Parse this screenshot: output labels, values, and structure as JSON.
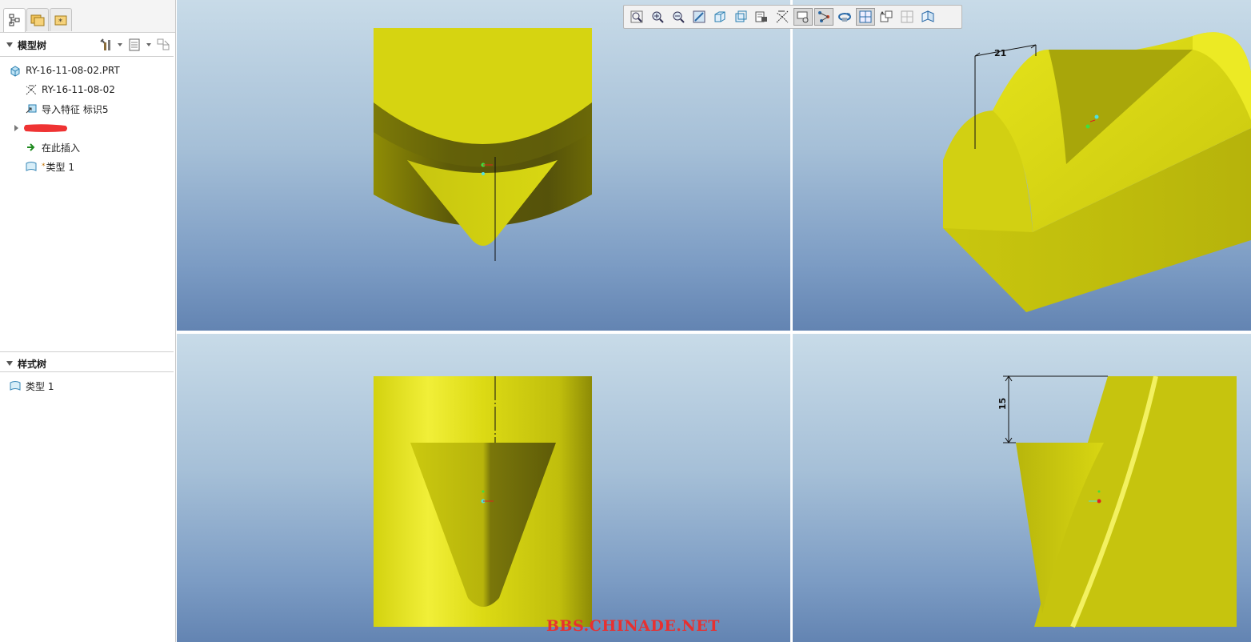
{
  "model_tree": {
    "title": "模型树",
    "items": [
      {
        "label": "RY-16-11-08-02.PRT",
        "icon": "part-icon"
      },
      {
        "label": "RY-16-11-08-02",
        "icon": "csys-icon"
      },
      {
        "label": "导入特征 标识5",
        "icon": "import-feature-icon"
      },
      {
        "label": "",
        "icon": "redacted-item"
      },
      {
        "label": "在此插入",
        "icon": "insert-here-arrow-icon"
      },
      {
        "label": "类型 1",
        "icon": "style-icon"
      }
    ]
  },
  "style_tree": {
    "title": "样式树",
    "items": [
      {
        "label": "类型 1",
        "icon": "style-icon"
      }
    ]
  },
  "toolbar": {
    "buttons": [
      "refit-icon",
      "zoom-in-icon",
      "zoom-out-icon",
      "repaint-icon",
      "display-style-icon",
      "saved-views-icon",
      "view-manager-icon",
      "datum-display-icon",
      "spin-center-icon",
      "annotation-display-icon",
      "orient-icon",
      "multi-view-icon",
      "split-view-icon",
      "layer-icon",
      "section-icon"
    ],
    "pressed": [
      "view-manager-icon",
      "datum-display-icon",
      "multi-view-icon"
    ]
  },
  "dimensions": {
    "top_right": "21",
    "bottom_right": "15"
  },
  "colors": {
    "model_yellow": "#d6d411",
    "viewport_top": "#c8dbe8",
    "viewport_bottom": "#6384b2",
    "watermark": "#e83030"
  },
  "watermark": "BBS.CHINADE.NET"
}
